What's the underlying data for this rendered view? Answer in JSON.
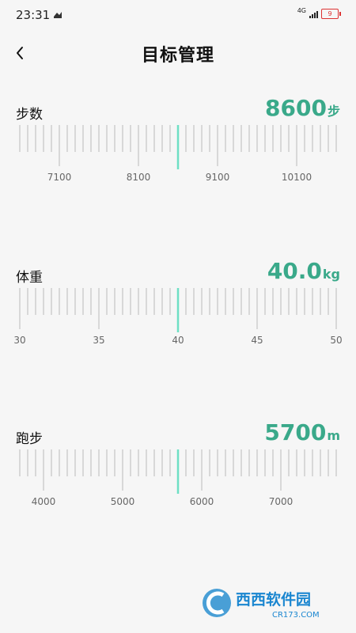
{
  "status": {
    "time": "23:31",
    "network": "4G",
    "battery": "9"
  },
  "header": {
    "title": "目标管理"
  },
  "sections": [
    {
      "label": "步数",
      "value": "8600",
      "unit": "步",
      "tick_labels": [
        "7100",
        "8100",
        "9100",
        "10100"
      ],
      "current": 8600
    },
    {
      "label": "体重",
      "value": "40.0",
      "unit": "kg",
      "tick_labels": [
        "30",
        "35",
        "40",
        "45",
        "50"
      ],
      "current": 40
    },
    {
      "label": "跑步",
      "value": "5700",
      "unit": "m",
      "tick_labels": [
        "4000",
        "5000",
        "6000",
        "7000"
      ],
      "current": 5700
    }
  ],
  "watermark": {
    "brand": "西西软件园",
    "site": "CR173.COM"
  },
  "colors": {
    "accent": "#3aa98a",
    "indicator": "#6ee0c4",
    "tick": "#cfcfcf"
  }
}
